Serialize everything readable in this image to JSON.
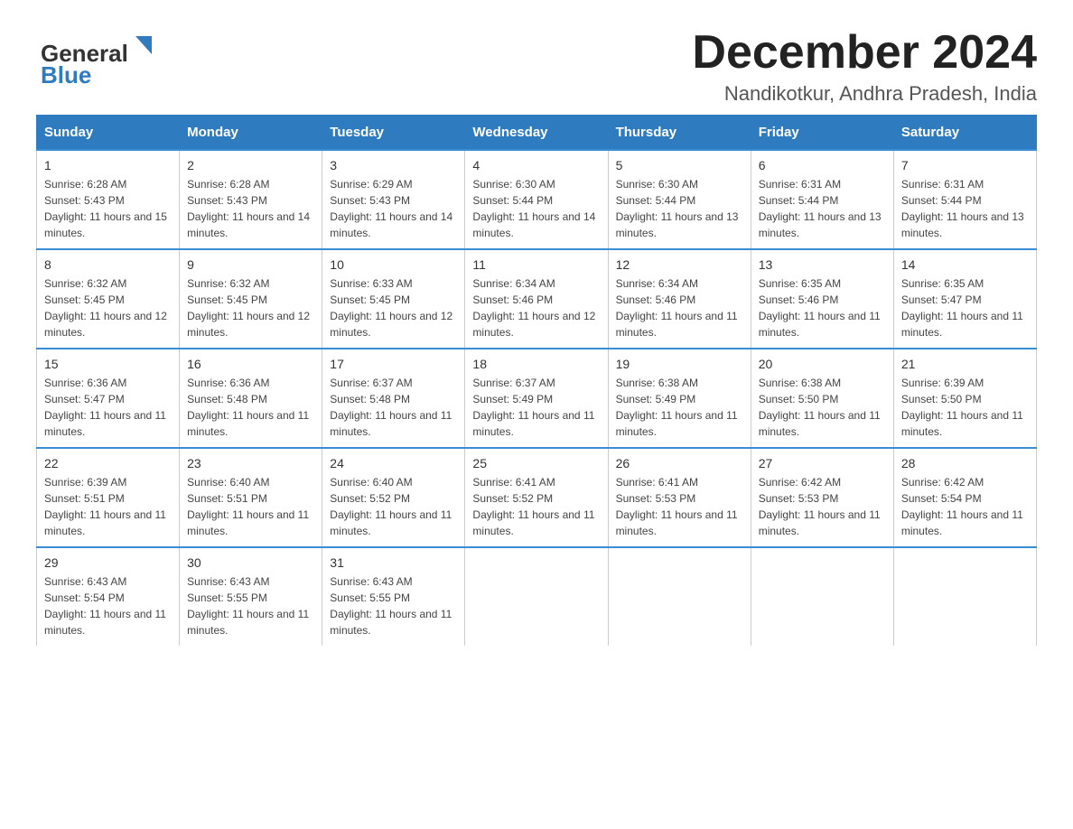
{
  "header": {
    "logo_general": "General",
    "logo_blue": "Blue",
    "title": "December 2024",
    "subtitle": "Nandikotkur, Andhra Pradesh, India"
  },
  "calendar": {
    "days": [
      "Sunday",
      "Monday",
      "Tuesday",
      "Wednesday",
      "Thursday",
      "Friday",
      "Saturday"
    ],
    "weeks": [
      [
        {
          "day": 1,
          "sunrise": "6:28 AM",
          "sunset": "5:43 PM",
          "daylight": "11 hours and 15 minutes."
        },
        {
          "day": 2,
          "sunrise": "6:28 AM",
          "sunset": "5:43 PM",
          "daylight": "11 hours and 14 minutes."
        },
        {
          "day": 3,
          "sunrise": "6:29 AM",
          "sunset": "5:43 PM",
          "daylight": "11 hours and 14 minutes."
        },
        {
          "day": 4,
          "sunrise": "6:30 AM",
          "sunset": "5:44 PM",
          "daylight": "11 hours and 14 minutes."
        },
        {
          "day": 5,
          "sunrise": "6:30 AM",
          "sunset": "5:44 PM",
          "daylight": "11 hours and 13 minutes."
        },
        {
          "day": 6,
          "sunrise": "6:31 AM",
          "sunset": "5:44 PM",
          "daylight": "11 hours and 13 minutes."
        },
        {
          "day": 7,
          "sunrise": "6:31 AM",
          "sunset": "5:44 PM",
          "daylight": "11 hours and 13 minutes."
        }
      ],
      [
        {
          "day": 8,
          "sunrise": "6:32 AM",
          "sunset": "5:45 PM",
          "daylight": "11 hours and 12 minutes."
        },
        {
          "day": 9,
          "sunrise": "6:32 AM",
          "sunset": "5:45 PM",
          "daylight": "11 hours and 12 minutes."
        },
        {
          "day": 10,
          "sunrise": "6:33 AM",
          "sunset": "5:45 PM",
          "daylight": "11 hours and 12 minutes."
        },
        {
          "day": 11,
          "sunrise": "6:34 AM",
          "sunset": "5:46 PM",
          "daylight": "11 hours and 12 minutes."
        },
        {
          "day": 12,
          "sunrise": "6:34 AM",
          "sunset": "5:46 PM",
          "daylight": "11 hours and 11 minutes."
        },
        {
          "day": 13,
          "sunrise": "6:35 AM",
          "sunset": "5:46 PM",
          "daylight": "11 hours and 11 minutes."
        },
        {
          "day": 14,
          "sunrise": "6:35 AM",
          "sunset": "5:47 PM",
          "daylight": "11 hours and 11 minutes."
        }
      ],
      [
        {
          "day": 15,
          "sunrise": "6:36 AM",
          "sunset": "5:47 PM",
          "daylight": "11 hours and 11 minutes."
        },
        {
          "day": 16,
          "sunrise": "6:36 AM",
          "sunset": "5:48 PM",
          "daylight": "11 hours and 11 minutes."
        },
        {
          "day": 17,
          "sunrise": "6:37 AM",
          "sunset": "5:48 PM",
          "daylight": "11 hours and 11 minutes."
        },
        {
          "day": 18,
          "sunrise": "6:37 AM",
          "sunset": "5:49 PM",
          "daylight": "11 hours and 11 minutes."
        },
        {
          "day": 19,
          "sunrise": "6:38 AM",
          "sunset": "5:49 PM",
          "daylight": "11 hours and 11 minutes."
        },
        {
          "day": 20,
          "sunrise": "6:38 AM",
          "sunset": "5:50 PM",
          "daylight": "11 hours and 11 minutes."
        },
        {
          "day": 21,
          "sunrise": "6:39 AM",
          "sunset": "5:50 PM",
          "daylight": "11 hours and 11 minutes."
        }
      ],
      [
        {
          "day": 22,
          "sunrise": "6:39 AM",
          "sunset": "5:51 PM",
          "daylight": "11 hours and 11 minutes."
        },
        {
          "day": 23,
          "sunrise": "6:40 AM",
          "sunset": "5:51 PM",
          "daylight": "11 hours and 11 minutes."
        },
        {
          "day": 24,
          "sunrise": "6:40 AM",
          "sunset": "5:52 PM",
          "daylight": "11 hours and 11 minutes."
        },
        {
          "day": 25,
          "sunrise": "6:41 AM",
          "sunset": "5:52 PM",
          "daylight": "11 hours and 11 minutes."
        },
        {
          "day": 26,
          "sunrise": "6:41 AM",
          "sunset": "5:53 PM",
          "daylight": "11 hours and 11 minutes."
        },
        {
          "day": 27,
          "sunrise": "6:42 AM",
          "sunset": "5:53 PM",
          "daylight": "11 hours and 11 minutes."
        },
        {
          "day": 28,
          "sunrise": "6:42 AM",
          "sunset": "5:54 PM",
          "daylight": "11 hours and 11 minutes."
        }
      ],
      [
        {
          "day": 29,
          "sunrise": "6:43 AM",
          "sunset": "5:54 PM",
          "daylight": "11 hours and 11 minutes."
        },
        {
          "day": 30,
          "sunrise": "6:43 AM",
          "sunset": "5:55 PM",
          "daylight": "11 hours and 11 minutes."
        },
        {
          "day": 31,
          "sunrise": "6:43 AM",
          "sunset": "5:55 PM",
          "daylight": "11 hours and 11 minutes."
        },
        null,
        null,
        null,
        null
      ]
    ]
  }
}
